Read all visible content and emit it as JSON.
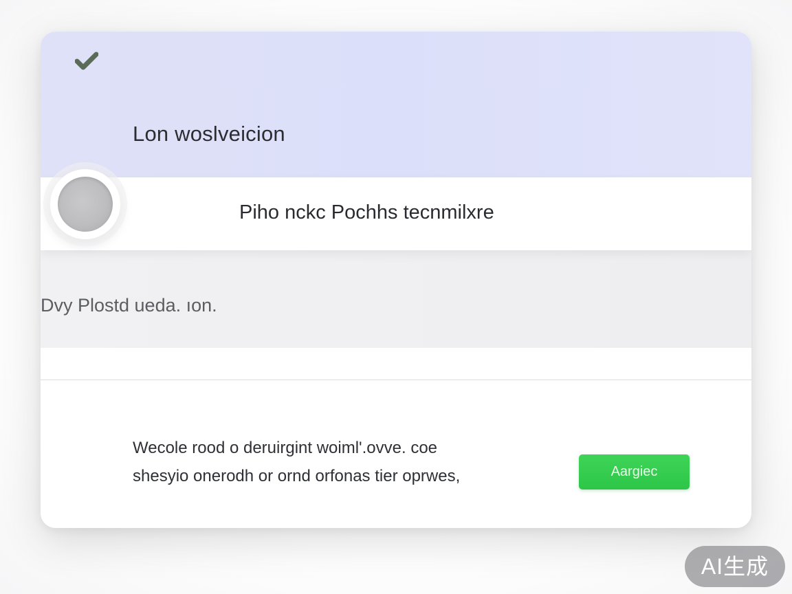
{
  "dialog": {
    "header_title": "Lon woslveicion",
    "row_title": "Piho nckc Pochhs tecnmilxre",
    "row_gray_text": "Dvy Plostd ueda. ıon.",
    "footer_text_line1": "Wecole rood o deruirgint woiml'.ovve. coe",
    "footer_text_line2": "shesyio onerodh or ornd orfonas tier oprwes,",
    "accept_button_label": "Aargiec"
  },
  "badge": {
    "label": "AI生成"
  },
  "icons": {
    "header_icon": "checkmark-icon",
    "toggle_icon": "radio-knob"
  },
  "colors": {
    "header_bg": "#dcdff9",
    "accent_green": "#34cc4f",
    "check_color": "#5a6b58"
  }
}
